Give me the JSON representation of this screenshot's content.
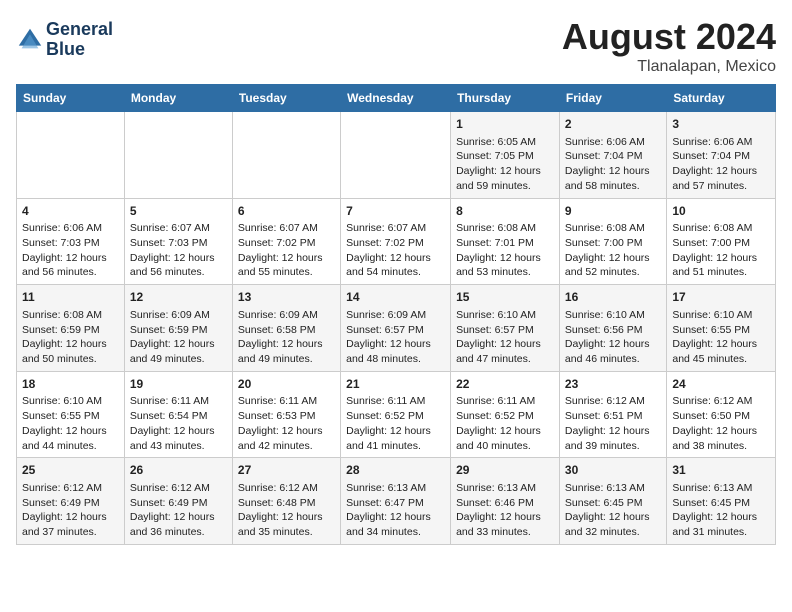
{
  "logo": {
    "line1": "General",
    "line2": "Blue"
  },
  "title": "August 2024",
  "subtitle": "Tlanalapan, Mexico",
  "headers": [
    "Sunday",
    "Monday",
    "Tuesday",
    "Wednesday",
    "Thursday",
    "Friday",
    "Saturday"
  ],
  "weeks": [
    [
      {
        "day": "",
        "sunrise": "",
        "sunset": "",
        "daylight": ""
      },
      {
        "day": "",
        "sunrise": "",
        "sunset": "",
        "daylight": ""
      },
      {
        "day": "",
        "sunrise": "",
        "sunset": "",
        "daylight": ""
      },
      {
        "day": "",
        "sunrise": "",
        "sunset": "",
        "daylight": ""
      },
      {
        "day": "1",
        "sunrise": "Sunrise: 6:05 AM",
        "sunset": "Sunset: 7:05 PM",
        "daylight": "Daylight: 12 hours and 59 minutes."
      },
      {
        "day": "2",
        "sunrise": "Sunrise: 6:06 AM",
        "sunset": "Sunset: 7:04 PM",
        "daylight": "Daylight: 12 hours and 58 minutes."
      },
      {
        "day": "3",
        "sunrise": "Sunrise: 6:06 AM",
        "sunset": "Sunset: 7:04 PM",
        "daylight": "Daylight: 12 hours and 57 minutes."
      }
    ],
    [
      {
        "day": "4",
        "sunrise": "Sunrise: 6:06 AM",
        "sunset": "Sunset: 7:03 PM",
        "daylight": "Daylight: 12 hours and 56 minutes."
      },
      {
        "day": "5",
        "sunrise": "Sunrise: 6:07 AM",
        "sunset": "Sunset: 7:03 PM",
        "daylight": "Daylight: 12 hours and 56 minutes."
      },
      {
        "day": "6",
        "sunrise": "Sunrise: 6:07 AM",
        "sunset": "Sunset: 7:02 PM",
        "daylight": "Daylight: 12 hours and 55 minutes."
      },
      {
        "day": "7",
        "sunrise": "Sunrise: 6:07 AM",
        "sunset": "Sunset: 7:02 PM",
        "daylight": "Daylight: 12 hours and 54 minutes."
      },
      {
        "day": "8",
        "sunrise": "Sunrise: 6:08 AM",
        "sunset": "Sunset: 7:01 PM",
        "daylight": "Daylight: 12 hours and 53 minutes."
      },
      {
        "day": "9",
        "sunrise": "Sunrise: 6:08 AM",
        "sunset": "Sunset: 7:00 PM",
        "daylight": "Daylight: 12 hours and 52 minutes."
      },
      {
        "day": "10",
        "sunrise": "Sunrise: 6:08 AM",
        "sunset": "Sunset: 7:00 PM",
        "daylight": "Daylight: 12 hours and 51 minutes."
      }
    ],
    [
      {
        "day": "11",
        "sunrise": "Sunrise: 6:08 AM",
        "sunset": "Sunset: 6:59 PM",
        "daylight": "Daylight: 12 hours and 50 minutes."
      },
      {
        "day": "12",
        "sunrise": "Sunrise: 6:09 AM",
        "sunset": "Sunset: 6:59 PM",
        "daylight": "Daylight: 12 hours and 49 minutes."
      },
      {
        "day": "13",
        "sunrise": "Sunrise: 6:09 AM",
        "sunset": "Sunset: 6:58 PM",
        "daylight": "Daylight: 12 hours and 49 minutes."
      },
      {
        "day": "14",
        "sunrise": "Sunrise: 6:09 AM",
        "sunset": "Sunset: 6:57 PM",
        "daylight": "Daylight: 12 hours and 48 minutes."
      },
      {
        "day": "15",
        "sunrise": "Sunrise: 6:10 AM",
        "sunset": "Sunset: 6:57 PM",
        "daylight": "Daylight: 12 hours and 47 minutes."
      },
      {
        "day": "16",
        "sunrise": "Sunrise: 6:10 AM",
        "sunset": "Sunset: 6:56 PM",
        "daylight": "Daylight: 12 hours and 46 minutes."
      },
      {
        "day": "17",
        "sunrise": "Sunrise: 6:10 AM",
        "sunset": "Sunset: 6:55 PM",
        "daylight": "Daylight: 12 hours and 45 minutes."
      }
    ],
    [
      {
        "day": "18",
        "sunrise": "Sunrise: 6:10 AM",
        "sunset": "Sunset: 6:55 PM",
        "daylight": "Daylight: 12 hours and 44 minutes."
      },
      {
        "day": "19",
        "sunrise": "Sunrise: 6:11 AM",
        "sunset": "Sunset: 6:54 PM",
        "daylight": "Daylight: 12 hours and 43 minutes."
      },
      {
        "day": "20",
        "sunrise": "Sunrise: 6:11 AM",
        "sunset": "Sunset: 6:53 PM",
        "daylight": "Daylight: 12 hours and 42 minutes."
      },
      {
        "day": "21",
        "sunrise": "Sunrise: 6:11 AM",
        "sunset": "Sunset: 6:52 PM",
        "daylight": "Daylight: 12 hours and 41 minutes."
      },
      {
        "day": "22",
        "sunrise": "Sunrise: 6:11 AM",
        "sunset": "Sunset: 6:52 PM",
        "daylight": "Daylight: 12 hours and 40 minutes."
      },
      {
        "day": "23",
        "sunrise": "Sunrise: 6:12 AM",
        "sunset": "Sunset: 6:51 PM",
        "daylight": "Daylight: 12 hours and 39 minutes."
      },
      {
        "day": "24",
        "sunrise": "Sunrise: 6:12 AM",
        "sunset": "Sunset: 6:50 PM",
        "daylight": "Daylight: 12 hours and 38 minutes."
      }
    ],
    [
      {
        "day": "25",
        "sunrise": "Sunrise: 6:12 AM",
        "sunset": "Sunset: 6:49 PM",
        "daylight": "Daylight: 12 hours and 37 minutes."
      },
      {
        "day": "26",
        "sunrise": "Sunrise: 6:12 AM",
        "sunset": "Sunset: 6:49 PM",
        "daylight": "Daylight: 12 hours and 36 minutes."
      },
      {
        "day": "27",
        "sunrise": "Sunrise: 6:12 AM",
        "sunset": "Sunset: 6:48 PM",
        "daylight": "Daylight: 12 hours and 35 minutes."
      },
      {
        "day": "28",
        "sunrise": "Sunrise: 6:13 AM",
        "sunset": "Sunset: 6:47 PM",
        "daylight": "Daylight: 12 hours and 34 minutes."
      },
      {
        "day": "29",
        "sunrise": "Sunrise: 6:13 AM",
        "sunset": "Sunset: 6:46 PM",
        "daylight": "Daylight: 12 hours and 33 minutes."
      },
      {
        "day": "30",
        "sunrise": "Sunrise: 6:13 AM",
        "sunset": "Sunset: 6:45 PM",
        "daylight": "Daylight: 12 hours and 32 minutes."
      },
      {
        "day": "31",
        "sunrise": "Sunrise: 6:13 AM",
        "sunset": "Sunset: 6:45 PM",
        "daylight": "Daylight: 12 hours and 31 minutes."
      }
    ]
  ]
}
